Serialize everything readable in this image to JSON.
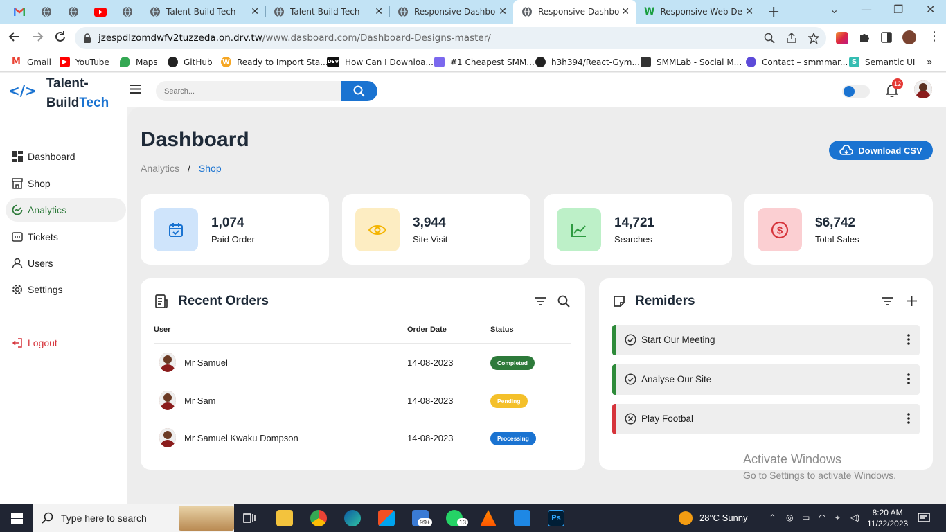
{
  "browser": {
    "tabs": [
      {
        "title": "Talent-Build Tech"
      },
      {
        "title": "Talent-Build Tech"
      },
      {
        "title": "Responsive Dashboa"
      },
      {
        "title": "Responsive Dashbo"
      },
      {
        "title": "Responsive Web Des"
      }
    ],
    "url_domain": "jzespdlzomdwfv2tuzzeda.on.drv.tw",
    "url_path": "/www.dasboard.com/Dashboard-Designs-master/",
    "bookmarks": [
      {
        "label": "Gmail"
      },
      {
        "label": "YouTube"
      },
      {
        "label": "Maps"
      },
      {
        "label": "GitHub"
      },
      {
        "label": "Ready to Import Sta..."
      },
      {
        "label": "How Can I Downloa..."
      },
      {
        "label": "#1 Cheapest SMM..."
      },
      {
        "label": "h3h394/React-Gym..."
      },
      {
        "label": "SMMLab - Social M..."
      },
      {
        "label": "Contact – smmmar..."
      },
      {
        "label": "Semantic UI"
      }
    ]
  },
  "sidebar": {
    "brand_first": "Talent-",
    "brand_second": "Build",
    "brand_accent": "Tech",
    "items": [
      {
        "label": "Dashboard",
        "icon": "dashboard-icon"
      },
      {
        "label": "Shop",
        "icon": "store-icon"
      },
      {
        "label": "Analytics",
        "icon": "analytics-icon"
      },
      {
        "label": "Tickets",
        "icon": "ticket-icon"
      },
      {
        "label": "Users",
        "icon": "user-icon"
      },
      {
        "label": "Settings",
        "icon": "gear-icon"
      }
    ],
    "logout_label": "Logout"
  },
  "topbar": {
    "search_placeholder": "Search...",
    "notification_count": "12"
  },
  "main": {
    "title": "Dashboard",
    "breadcrumb": [
      "Analytics",
      "/",
      "Shop"
    ],
    "download_label": "Download CSV",
    "cards": [
      {
        "value": "1,074",
        "label": "Paid Order",
        "color": "#1a73d1",
        "bg": "#cfe4fb"
      },
      {
        "value": "3,944",
        "label": "Site Visit",
        "color": "#f4b400",
        "bg": "#fdedc2"
      },
      {
        "value": "14,721",
        "label": "Searches",
        "color": "#2e9b41",
        "bg": "#bdf0c8"
      },
      {
        "value": "$6,742",
        "label": "Total Sales",
        "color": "#d6343b",
        "bg": "#fbcfd2"
      }
    ],
    "orders": {
      "title": "Recent Orders",
      "columns": [
        "User",
        "Order Date",
        "Status"
      ],
      "rows": [
        {
          "user": "Mr Samuel",
          "date": "14-08-2023",
          "status": "Completed",
          "status_color": "#2d7a3a"
        },
        {
          "user": "Mr Sam",
          "date": "14-08-2023",
          "status": "Pending",
          "status_color": "#f4c02a"
        },
        {
          "user": "Mr Samuel Kwaku Dompson",
          "date": "14-08-2023",
          "status": "Processing",
          "status_color": "#1a73d1"
        }
      ]
    },
    "reminders": {
      "title": "Remiders",
      "items": [
        {
          "label": "Start Our Meeting",
          "accent": "#2e8b3a",
          "icon": "check-circle-icon"
        },
        {
          "label": "Analyse Our Site",
          "accent": "#2e8b3a",
          "icon": "check-circle-icon"
        },
        {
          "label": "Play Footbal",
          "accent": "#d6343b",
          "icon": "close-circle-icon"
        }
      ]
    }
  },
  "watermark": {
    "line1": "Activate Windows",
    "line2": "Go to Settings to activate Windows."
  },
  "taskbar": {
    "search_placeholder": "Type here to search",
    "weather": "28°C  Sunny",
    "time": "8:20 AM",
    "date": "11/22/2023",
    "mail_badge": "99+",
    "whatsapp_badge": "13"
  }
}
